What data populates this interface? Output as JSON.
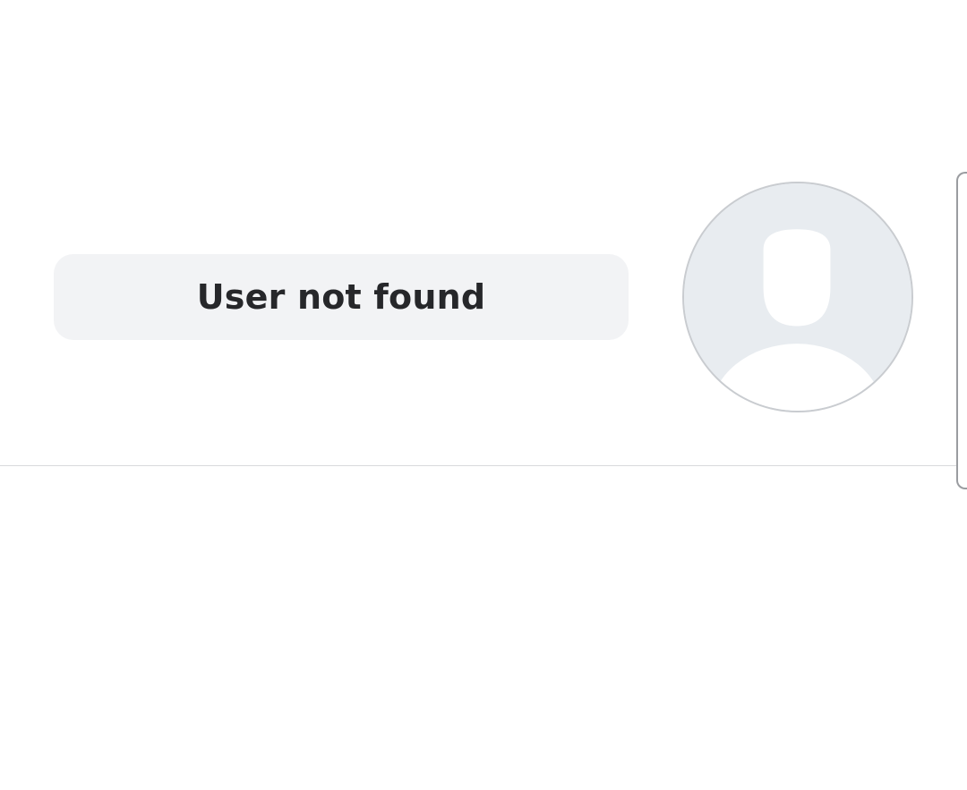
{
  "profile": {
    "status_message": "User not found",
    "avatar_icon": "default-user-icon"
  },
  "colors": {
    "pill_background": "#f2f3f5",
    "text": "#26272a",
    "avatar_background": "#e8ecf0",
    "avatar_border": "#c9ccd0",
    "divider": "#d9dadc"
  }
}
